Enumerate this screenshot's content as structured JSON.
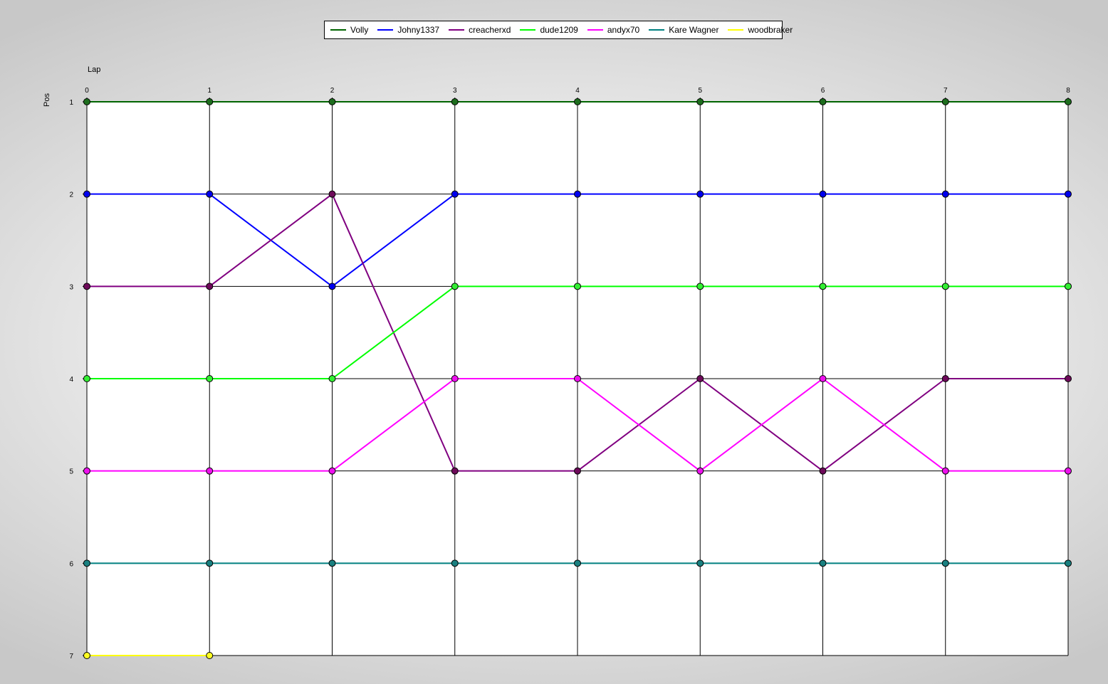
{
  "chart_data": {
    "type": "line",
    "xlabel": "Lap",
    "ylabel": "Pos",
    "x": [
      0,
      1,
      2,
      3,
      4,
      5,
      6,
      7,
      8
    ],
    "xlim": [
      0,
      8
    ],
    "ylim": [
      1,
      7
    ],
    "y_inverted": true,
    "x_ticks": [
      0,
      1,
      2,
      3,
      4,
      5,
      6,
      7,
      8
    ],
    "y_ticks": [
      1,
      2,
      3,
      4,
      5,
      6,
      7
    ],
    "grid": true,
    "legend_position": "top",
    "series": [
      {
        "name": "Volly",
        "color": "#006400",
        "marker_color": "#1e6e1e",
        "values": [
          1,
          1,
          1,
          1,
          1,
          1,
          1,
          1,
          1
        ]
      },
      {
        "name": "Johny1337",
        "color": "#0000ff",
        "marker_color": "#0000ee",
        "values": [
          2,
          2,
          3,
          2,
          2,
          2,
          2,
          2,
          2
        ]
      },
      {
        "name": "creacherxd",
        "color": "#800080",
        "marker_color": "#6e0a5a",
        "values": [
          3,
          3,
          2,
          5,
          5,
          4,
          5,
          4,
          4
        ]
      },
      {
        "name": "dude1209",
        "color": "#00ff00",
        "marker_color": "#33ee33",
        "values": [
          4,
          4,
          4,
          3,
          3,
          3,
          3,
          3,
          3
        ]
      },
      {
        "name": "andyx70",
        "color": "#ff00ff",
        "marker_color": "#ee11ee",
        "values": [
          5,
          5,
          5,
          4,
          4,
          5,
          4,
          5,
          5
        ]
      },
      {
        "name": "Kare Wagner",
        "color": "#008080",
        "marker_color": "#1a8080",
        "values": [
          6,
          6,
          6,
          6,
          6,
          6,
          6,
          6,
          6
        ]
      },
      {
        "name": "woodbraker",
        "color": "#ffff00",
        "marker_color": "#ffff22",
        "values": [
          7,
          7,
          null,
          null,
          null,
          null,
          null,
          null,
          null
        ]
      }
    ]
  }
}
